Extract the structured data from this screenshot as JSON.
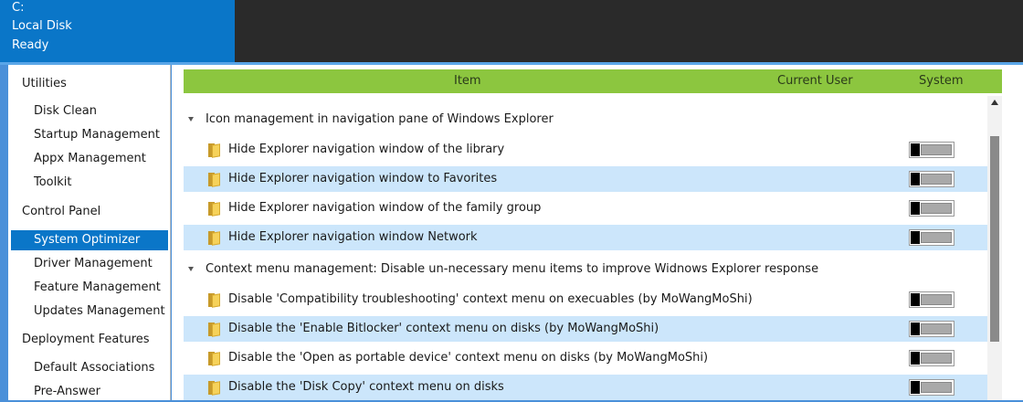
{
  "drive": {
    "letter": "C:",
    "name": "Local Disk",
    "status": "Ready"
  },
  "sidebar": {
    "items": [
      {
        "label": "Utilities",
        "kind": "category"
      },
      {
        "label": "Disk Clean",
        "kind": "item"
      },
      {
        "label": "Startup Management",
        "kind": "item"
      },
      {
        "label": "Appx Management",
        "kind": "item"
      },
      {
        "label": "Toolkit",
        "kind": "item"
      },
      {
        "label": "Control Panel",
        "kind": "category"
      },
      {
        "label": "System Optimizer",
        "kind": "item",
        "active": true
      },
      {
        "label": "Driver Management",
        "kind": "item"
      },
      {
        "label": "Feature Management",
        "kind": "item"
      },
      {
        "label": "Updates Management",
        "kind": "item"
      },
      {
        "label": "Deployment Features",
        "kind": "category"
      },
      {
        "label": "Default Associations",
        "kind": "item"
      },
      {
        "label": "Pre-Answer",
        "kind": "item"
      }
    ]
  },
  "table": {
    "columns": {
      "item": "Item",
      "current_user": "Current User",
      "system": "System"
    },
    "groups": [
      {
        "label": "Icon management in navigation pane of Windows Explorer",
        "rows": [
          "Hide Explorer navigation window of the library",
          "Hide Explorer navigation window to Favorites",
          "Hide Explorer navigation window of the family group",
          "Hide Explorer navigation window Network"
        ]
      },
      {
        "label": "Context menu management: Disable un-necessary menu items to improve Widnows Explorer response",
        "rows": [
          "Disable 'Compatibility troubleshooting' context menu on execuables (by MoWangMoShi)",
          "Disable the 'Enable Bitlocker' context menu on disks (by MoWangMoShi)",
          "Disable the 'Open as portable device' context menu on disks (by MoWangMoShi)",
          "Disable the 'Disk Copy' context menu on disks"
        ]
      }
    ]
  },
  "colors": {
    "accent": "#0a76c8",
    "header_green": "#8cc63f",
    "row_alt": "#cce6fb"
  },
  "icons": {
    "folder": "folder-icon",
    "toggle": "toggle-switch"
  }
}
